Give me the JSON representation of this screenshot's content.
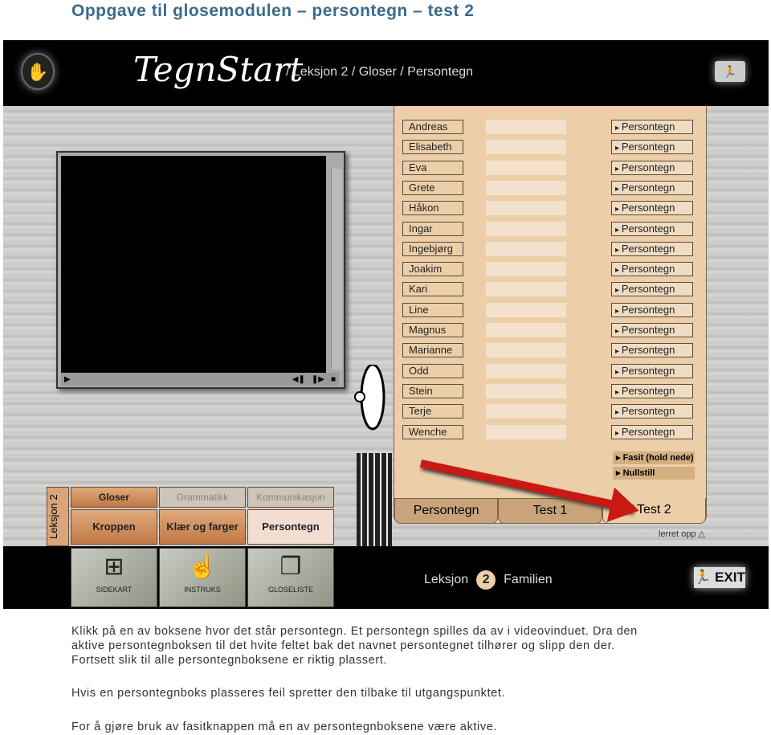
{
  "page_title": "Oppgave til glosemodulen – persontegn – test 2",
  "header": {
    "logo_icon": "hand-logo-icon",
    "brand": "TegnStart",
    "breadcrumb": "/  Leksjon 2  /  Gloser  /  Persontegn",
    "back_icon": "running-man-icon"
  },
  "video": {
    "controls": [
      "▶",
      "◀❚",
      "❚▶",
      "■"
    ]
  },
  "names": [
    "Andreas",
    "Elisabeth",
    "Eva",
    "Grete",
    "Håkon",
    "Ingar",
    "Ingebjørg",
    "Joakim",
    "Kari",
    "Line",
    "Magnus",
    "Marianne",
    "Odd",
    "Stein",
    "Terje",
    "Wenche"
  ],
  "sign_button_label": "Persontegn",
  "fasit_label": "▸ Fasit (hold nede)",
  "nullstill_label": "▸ Nullstill",
  "tabs": [
    "Persontegn",
    "Test 1",
    "Test 2"
  ],
  "active_tab": "Test 2",
  "lerret_label": "lerret opp △",
  "menu": {
    "leksjon": "Leksjon 2",
    "top": [
      "Gloser",
      "Grammatikk",
      "Kommunikasjon"
    ],
    "sub": [
      "Kroppen",
      "Klær og farger",
      "Persontegn"
    ]
  },
  "tools": [
    {
      "label": "SIDEKART",
      "icon": "sitemap-icon"
    },
    {
      "label": "INSTRUKS",
      "icon": "pointing-hand-icon"
    },
    {
      "label": "GLOSELISTE",
      "icon": "pages-icon"
    }
  ],
  "footer": {
    "leksjon": "Leksjon",
    "number": "2",
    "topic": "Familien",
    "exit": "EXIT"
  },
  "colors": {
    "panel": "#eccfa9",
    "arrow": "#c81a12",
    "title": "#3c6a8c"
  },
  "instructions": [
    "Klikk på en av boksene hvor det står persontegn. Et persontegn spilles da av i videovinduet. Dra den",
    "aktive persontegnboksen til det hvite feltet bak det navnet persontegnet tilhører og slipp den der.",
    "Fortsett slik til alle persontegnboksene er riktig plassert.",
    "Hvis en persontegnboks plasseres feil spretter den tilbake til utgangspunktet.",
    "For å gjøre bruk av fasitknappen må en av persontegnboksene være aktive."
  ]
}
